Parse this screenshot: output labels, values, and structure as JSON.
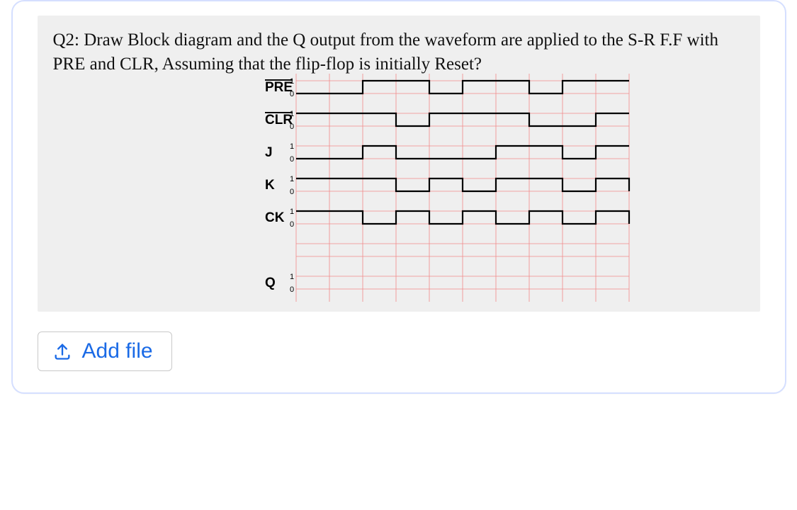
{
  "question": {
    "prefix": "Q2:",
    "text": "Draw Block diagram and the Q output from the waveform are applied to the S-R F.F with PRE and CLR, Assuming that the flip-flop is initially Reset?"
  },
  "add_file_label": "Add file",
  "chart_data": {
    "type": "timing-diagram",
    "grid": {
      "divisions": 10,
      "time_per_div": 1
    },
    "signals": [
      {
        "name": "PRE",
        "overline": true,
        "levels_label": [
          "1",
          "0"
        ],
        "values": [
          0,
          0,
          1,
          1,
          0,
          1,
          1,
          0,
          1,
          1,
          1
        ]
      },
      {
        "name": "CLR",
        "overline": true,
        "levels_label": [
          "1",
          "0"
        ],
        "values": [
          1,
          1,
          1,
          0,
          1,
          1,
          1,
          0,
          0,
          1,
          1
        ]
      },
      {
        "name": "J",
        "overline": false,
        "levels_label": [
          "1",
          "0"
        ],
        "values": [
          0,
          0,
          1,
          0,
          0,
          0,
          1,
          1,
          0,
          1,
          1
        ]
      },
      {
        "name": "K",
        "overline": false,
        "levels_label": [
          "1",
          "0"
        ],
        "values": [
          1,
          1,
          1,
          0,
          1,
          0,
          1,
          1,
          0,
          1,
          0
        ]
      },
      {
        "name": "CK",
        "overline": false,
        "levels_label": [
          "1",
          "0"
        ],
        "values": [
          1,
          1,
          0,
          1,
          0,
          1,
          0,
          1,
          0,
          1,
          0
        ]
      },
      {
        "name": "Q",
        "overline": false,
        "levels_label": [
          "1",
          "0"
        ],
        "values": null
      }
    ]
  }
}
